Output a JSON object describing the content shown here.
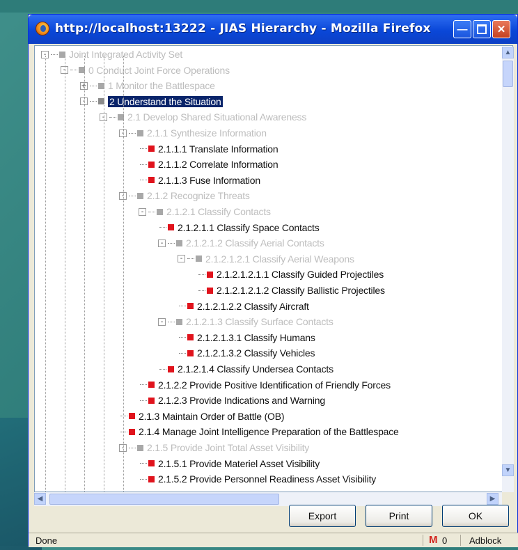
{
  "window": {
    "title": "http://localhost:13222 - JIAS Hierarchy - Mozilla Firefox"
  },
  "tree": {
    "nodes": [
      {
        "label": "Joint Integrated Activity Set",
        "depth": 0,
        "toggle": "-",
        "marker": "grey",
        "faded": true
      },
      {
        "label": "0 Conduct Joint Force Operations",
        "depth": 1,
        "toggle": "-",
        "marker": "grey",
        "faded": true
      },
      {
        "label": "1 Monitor the Battlespace",
        "depth": 2,
        "toggle": "+",
        "marker": "grey",
        "faded": true
      },
      {
        "label": "2 Understand the Situation",
        "depth": 2,
        "toggle": "-",
        "marker": "grey",
        "faded": false,
        "selected": true
      },
      {
        "label": "2.1 Develop Shared Situational Awareness",
        "depth": 3,
        "toggle": "-",
        "marker": "grey",
        "faded": true
      },
      {
        "label": "2.1.1 Synthesize Information",
        "depth": 4,
        "toggle": "-",
        "marker": "grey",
        "faded": true
      },
      {
        "label": "2.1.1.1 Translate Information",
        "depth": 5,
        "toggle": "",
        "marker": "red",
        "faded": false
      },
      {
        "label": "2.1.1.2 Correlate Information",
        "depth": 5,
        "toggle": "",
        "marker": "red",
        "faded": false
      },
      {
        "label": "2.1.1.3 Fuse Information",
        "depth": 5,
        "toggle": "",
        "marker": "red",
        "faded": false
      },
      {
        "label": "2.1.2 Recognize Threats",
        "depth": 4,
        "toggle": "-",
        "marker": "grey",
        "faded": true
      },
      {
        "label": "2.1.2.1 Classify Contacts",
        "depth": 5,
        "toggle": "-",
        "marker": "grey",
        "faded": true
      },
      {
        "label": "2.1.2.1.1 Classify Space Contacts",
        "depth": 6,
        "toggle": "",
        "marker": "red",
        "faded": false
      },
      {
        "label": "2.1.2.1.2 Classify Aerial Contacts",
        "depth": 6,
        "toggle": "-",
        "marker": "grey",
        "faded": true
      },
      {
        "label": "2.1.2.1.2.1 Classify Aerial Weapons",
        "depth": 7,
        "toggle": "-",
        "marker": "grey",
        "faded": true
      },
      {
        "label": "2.1.2.1.2.1.1 Classify Guided Projectiles",
        "depth": 8,
        "toggle": "",
        "marker": "red",
        "faded": false
      },
      {
        "label": "2.1.2.1.2.1.2 Classify Ballistic Projectiles",
        "depth": 8,
        "toggle": "",
        "marker": "red",
        "faded": false
      },
      {
        "label": "2.1.2.1.2.2 Classify Aircraft",
        "depth": 7,
        "toggle": "",
        "marker": "red",
        "faded": false
      },
      {
        "label": "2.1.2.1.3 Classify Surface Contacts",
        "depth": 6,
        "toggle": "-",
        "marker": "grey",
        "faded": true
      },
      {
        "label": "2.1.2.1.3.1 Classify Humans",
        "depth": 7,
        "toggle": "",
        "marker": "red",
        "faded": false
      },
      {
        "label": "2.1.2.1.3.2 Classify Vehicles",
        "depth": 7,
        "toggle": "",
        "marker": "red",
        "faded": false
      },
      {
        "label": "2.1.2.1.4 Classify Undersea Contacts",
        "depth": 6,
        "toggle": "",
        "marker": "red",
        "faded": false
      },
      {
        "label": "2.1.2.2 Provide Positive Identification of Friendly Forces",
        "depth": 5,
        "toggle": "",
        "marker": "red",
        "faded": false
      },
      {
        "label": "2.1.2.3 Provide Indications and Warning",
        "depth": 5,
        "toggle": "",
        "marker": "red",
        "faded": false
      },
      {
        "label": "2.1.3 Maintain Order of Battle (OB)",
        "depth": 4,
        "toggle": "",
        "marker": "red",
        "faded": false
      },
      {
        "label": "2.1.4 Manage Joint Intelligence Preparation of the Battlespace",
        "depth": 4,
        "toggle": "",
        "marker": "red",
        "faded": false
      },
      {
        "label": "2.1.5 Provide Joint Total Asset Visibility",
        "depth": 4,
        "toggle": "-",
        "marker": "grey",
        "faded": true
      },
      {
        "label": "2.1.5.1 Provide Materiel Asset Visibility",
        "depth": 5,
        "toggle": "",
        "marker": "red",
        "faded": false
      },
      {
        "label": "2.1.5.2 Provide Personnel Readiness Asset Visibility",
        "depth": 5,
        "toggle": "",
        "marker": "red",
        "faded": false
      }
    ]
  },
  "buttons": {
    "export": "Export",
    "print": "Print",
    "ok": "OK"
  },
  "status": {
    "text": "Done",
    "mail_count": "0",
    "adblock": "Adblock"
  },
  "colors": {
    "titlebar": "#0a47d8",
    "selection": "#0a246a",
    "leaf_marker": "#e0131c",
    "group_marker": "#8a8a8a"
  }
}
